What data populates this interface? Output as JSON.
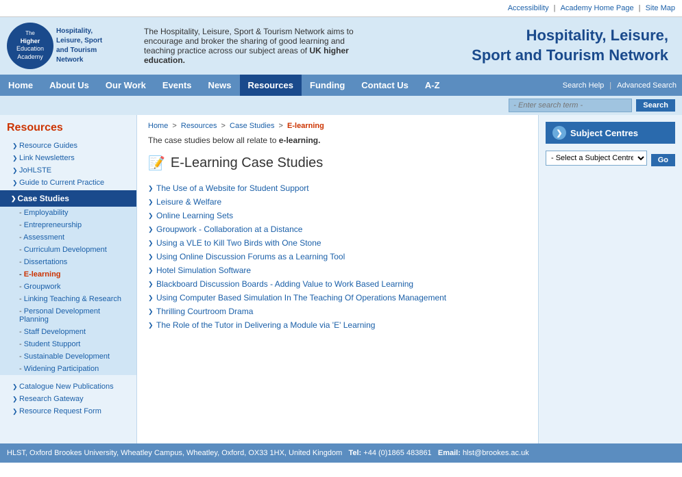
{
  "topbar": {
    "links": [
      "Accessibility",
      "Academy Home Page",
      "Site Map"
    ],
    "separators": [
      "|",
      "|"
    ]
  },
  "header": {
    "logo": {
      "the": "The",
      "higher": "Higher",
      "education": "Education",
      "academy": "Academy"
    },
    "network_name": "Hospitality, Leisure, Sport and Tourism Network",
    "description": "The Hospitality, Leisure, Sport & Tourism Network aims to encourage and broker the sharing of good learning and teaching practice across our subject areas of UK higher education.",
    "site_title_line1": "Hospitality, Leisure,",
    "site_title_line2": "Sport and Tourism Network"
  },
  "nav": {
    "items": [
      {
        "label": "Home",
        "active": false
      },
      {
        "label": "About Us",
        "active": false
      },
      {
        "label": "Our Work",
        "active": false
      },
      {
        "label": "Events",
        "active": false
      },
      {
        "label": "News",
        "active": false
      },
      {
        "label": "Resources",
        "active": true
      },
      {
        "label": "Funding",
        "active": false
      },
      {
        "label": "Contact Us",
        "active": false
      },
      {
        "label": "A-Z",
        "active": false
      }
    ],
    "search_help": "Search Help",
    "advanced_search": "Advanced Search"
  },
  "search": {
    "placeholder": "- Enter search term -",
    "button_label": "Search"
  },
  "sidebar": {
    "title": "Resources",
    "top_links": [
      "Resource Guides",
      "Link Newsletters",
      "JoHLSTE",
      "Guide to Current Practice"
    ],
    "active_section": "Case Studies",
    "sub_items": [
      {
        "label": "Employability",
        "active": false
      },
      {
        "label": "Entrepreneurship",
        "active": false
      },
      {
        "label": "Assessment",
        "active": false
      },
      {
        "label": "Curriculum Development",
        "active": false
      },
      {
        "label": "Dissertations",
        "active": false
      },
      {
        "label": "E-learning",
        "active": true
      },
      {
        "label": "Groupwork",
        "active": false
      },
      {
        "label": "Linking Teaching & Research",
        "active": false
      },
      {
        "label": "Personal Development Planning",
        "active": false
      },
      {
        "label": "Staff Development",
        "active": false
      },
      {
        "label": "Student Stupport",
        "active": false
      },
      {
        "label": "Sustainable Development",
        "active": false
      },
      {
        "label": "Widening Participation",
        "active": false
      }
    ],
    "bottom_links": [
      "Catalogue New Publications",
      "Research Gateway",
      "Resource Request Form"
    ]
  },
  "breadcrumb": {
    "items": [
      "Home",
      "Resources",
      "Case Studies"
    ],
    "current": "E-learning"
  },
  "main": {
    "intro": "The case studies below all relate to",
    "intro_bold": "e-learning.",
    "page_title": "E-Learning Case Studies",
    "case_studies": [
      "The Use of a Website for Student Support",
      "Leisure & Welfare",
      "Online Learning Sets",
      "Groupwork - Collaboration at a Distance",
      "Using a VLE to Kill Two Birds with One Stone",
      "Using Online Discussion Forums as a Learning Tool",
      "Hotel Simulation Software",
      "Blackboard Discussion Boards - Adding Value to Work Based Learning",
      "Using Computer Based Simulation In The Teaching Of Operations Management",
      "Thrilling Courtroom Drama",
      "The Role of the Tutor in Delivering a Module via 'E' Learning"
    ]
  },
  "right_panel": {
    "title": "Subject Centres",
    "select_default": "- Select a Subject Centre -",
    "go_label": "Go"
  },
  "footer": {
    "text": "HLST, Oxford Brookes University, Wheatley Campus, Wheatley, Oxford, OX33 1HX, United Kingdom",
    "tel_label": "Tel:",
    "tel": "+44 (0)1865 483861",
    "email_label": "Email:",
    "email": "hlst@brookes.ac.uk"
  }
}
